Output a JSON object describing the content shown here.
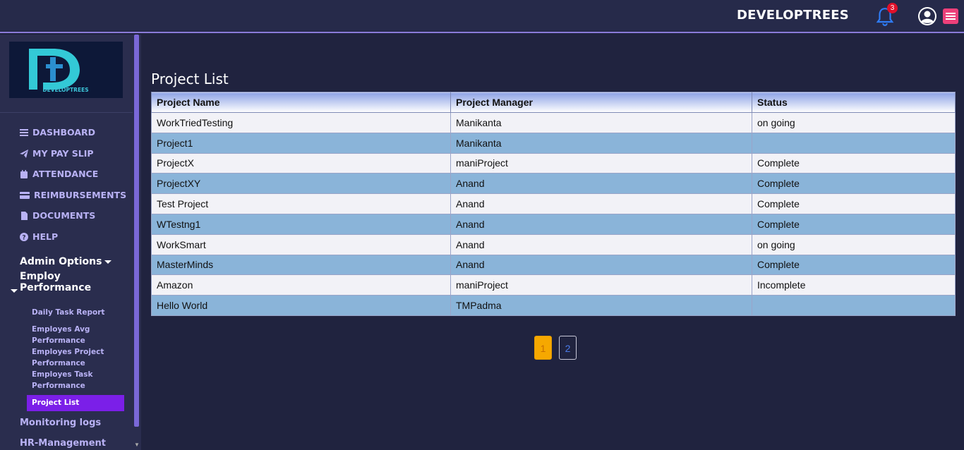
{
  "header": {
    "brand": "DEVELOPTREES",
    "notification_count": "3"
  },
  "sidebar": {
    "logo_text": "DEVELOPTREES",
    "nav": [
      {
        "label": "DASHBOARD",
        "icon": "bars-icon"
      },
      {
        "label": "MY PAY SLIP",
        "icon": "paper-plane-icon"
      },
      {
        "label": "ATTENDANCE",
        "icon": "calendar-icon"
      },
      {
        "label": "REIMBURSEMENTS",
        "icon": "credit-card-icon"
      },
      {
        "label": "DOCUMENTS",
        "icon": "file-icon"
      },
      {
        "label": "HELP",
        "icon": "question-circle-icon"
      }
    ],
    "admin_options": "Admin Options",
    "employ_performance": "Employ Performance",
    "sub_items": [
      "Daily Task Report",
      "Employes Avg Performance",
      "Employes Project Performance",
      "Employes Task Performance",
      "Project List"
    ],
    "monitoring_logs": "Monitoring logs",
    "hr_management": "HR-Management"
  },
  "main": {
    "title": "Project List",
    "columns": [
      "Project Name",
      "Project Manager",
      "Status"
    ],
    "rows": [
      [
        "WorkTriedTesting",
        "Manikanta",
        "on going"
      ],
      [
        "Project1",
        "Manikanta",
        ""
      ],
      [
        "ProjectX",
        "maniProject",
        "Complete"
      ],
      [
        "ProjectXY",
        "Anand",
        "Complete"
      ],
      [
        "Test Project",
        "Anand",
        "Complete"
      ],
      [
        "WTestng1",
        "Anand",
        "Complete"
      ],
      [
        "WorkSmart",
        "Anand",
        "on going"
      ],
      [
        "MasterMinds",
        "Anand",
        "Complete"
      ],
      [
        "Amazon",
        "maniProject",
        "Incomplete"
      ],
      [
        "Hello World",
        "TMPadma",
        ""
      ]
    ],
    "pagination": [
      "1",
      "2"
    ],
    "active_page": "1"
  },
  "colors": {
    "accent": "#7b1fe8",
    "row_alt": "#8ab4d9",
    "page_active": "#f6a800",
    "badge": "#e0102a"
  }
}
